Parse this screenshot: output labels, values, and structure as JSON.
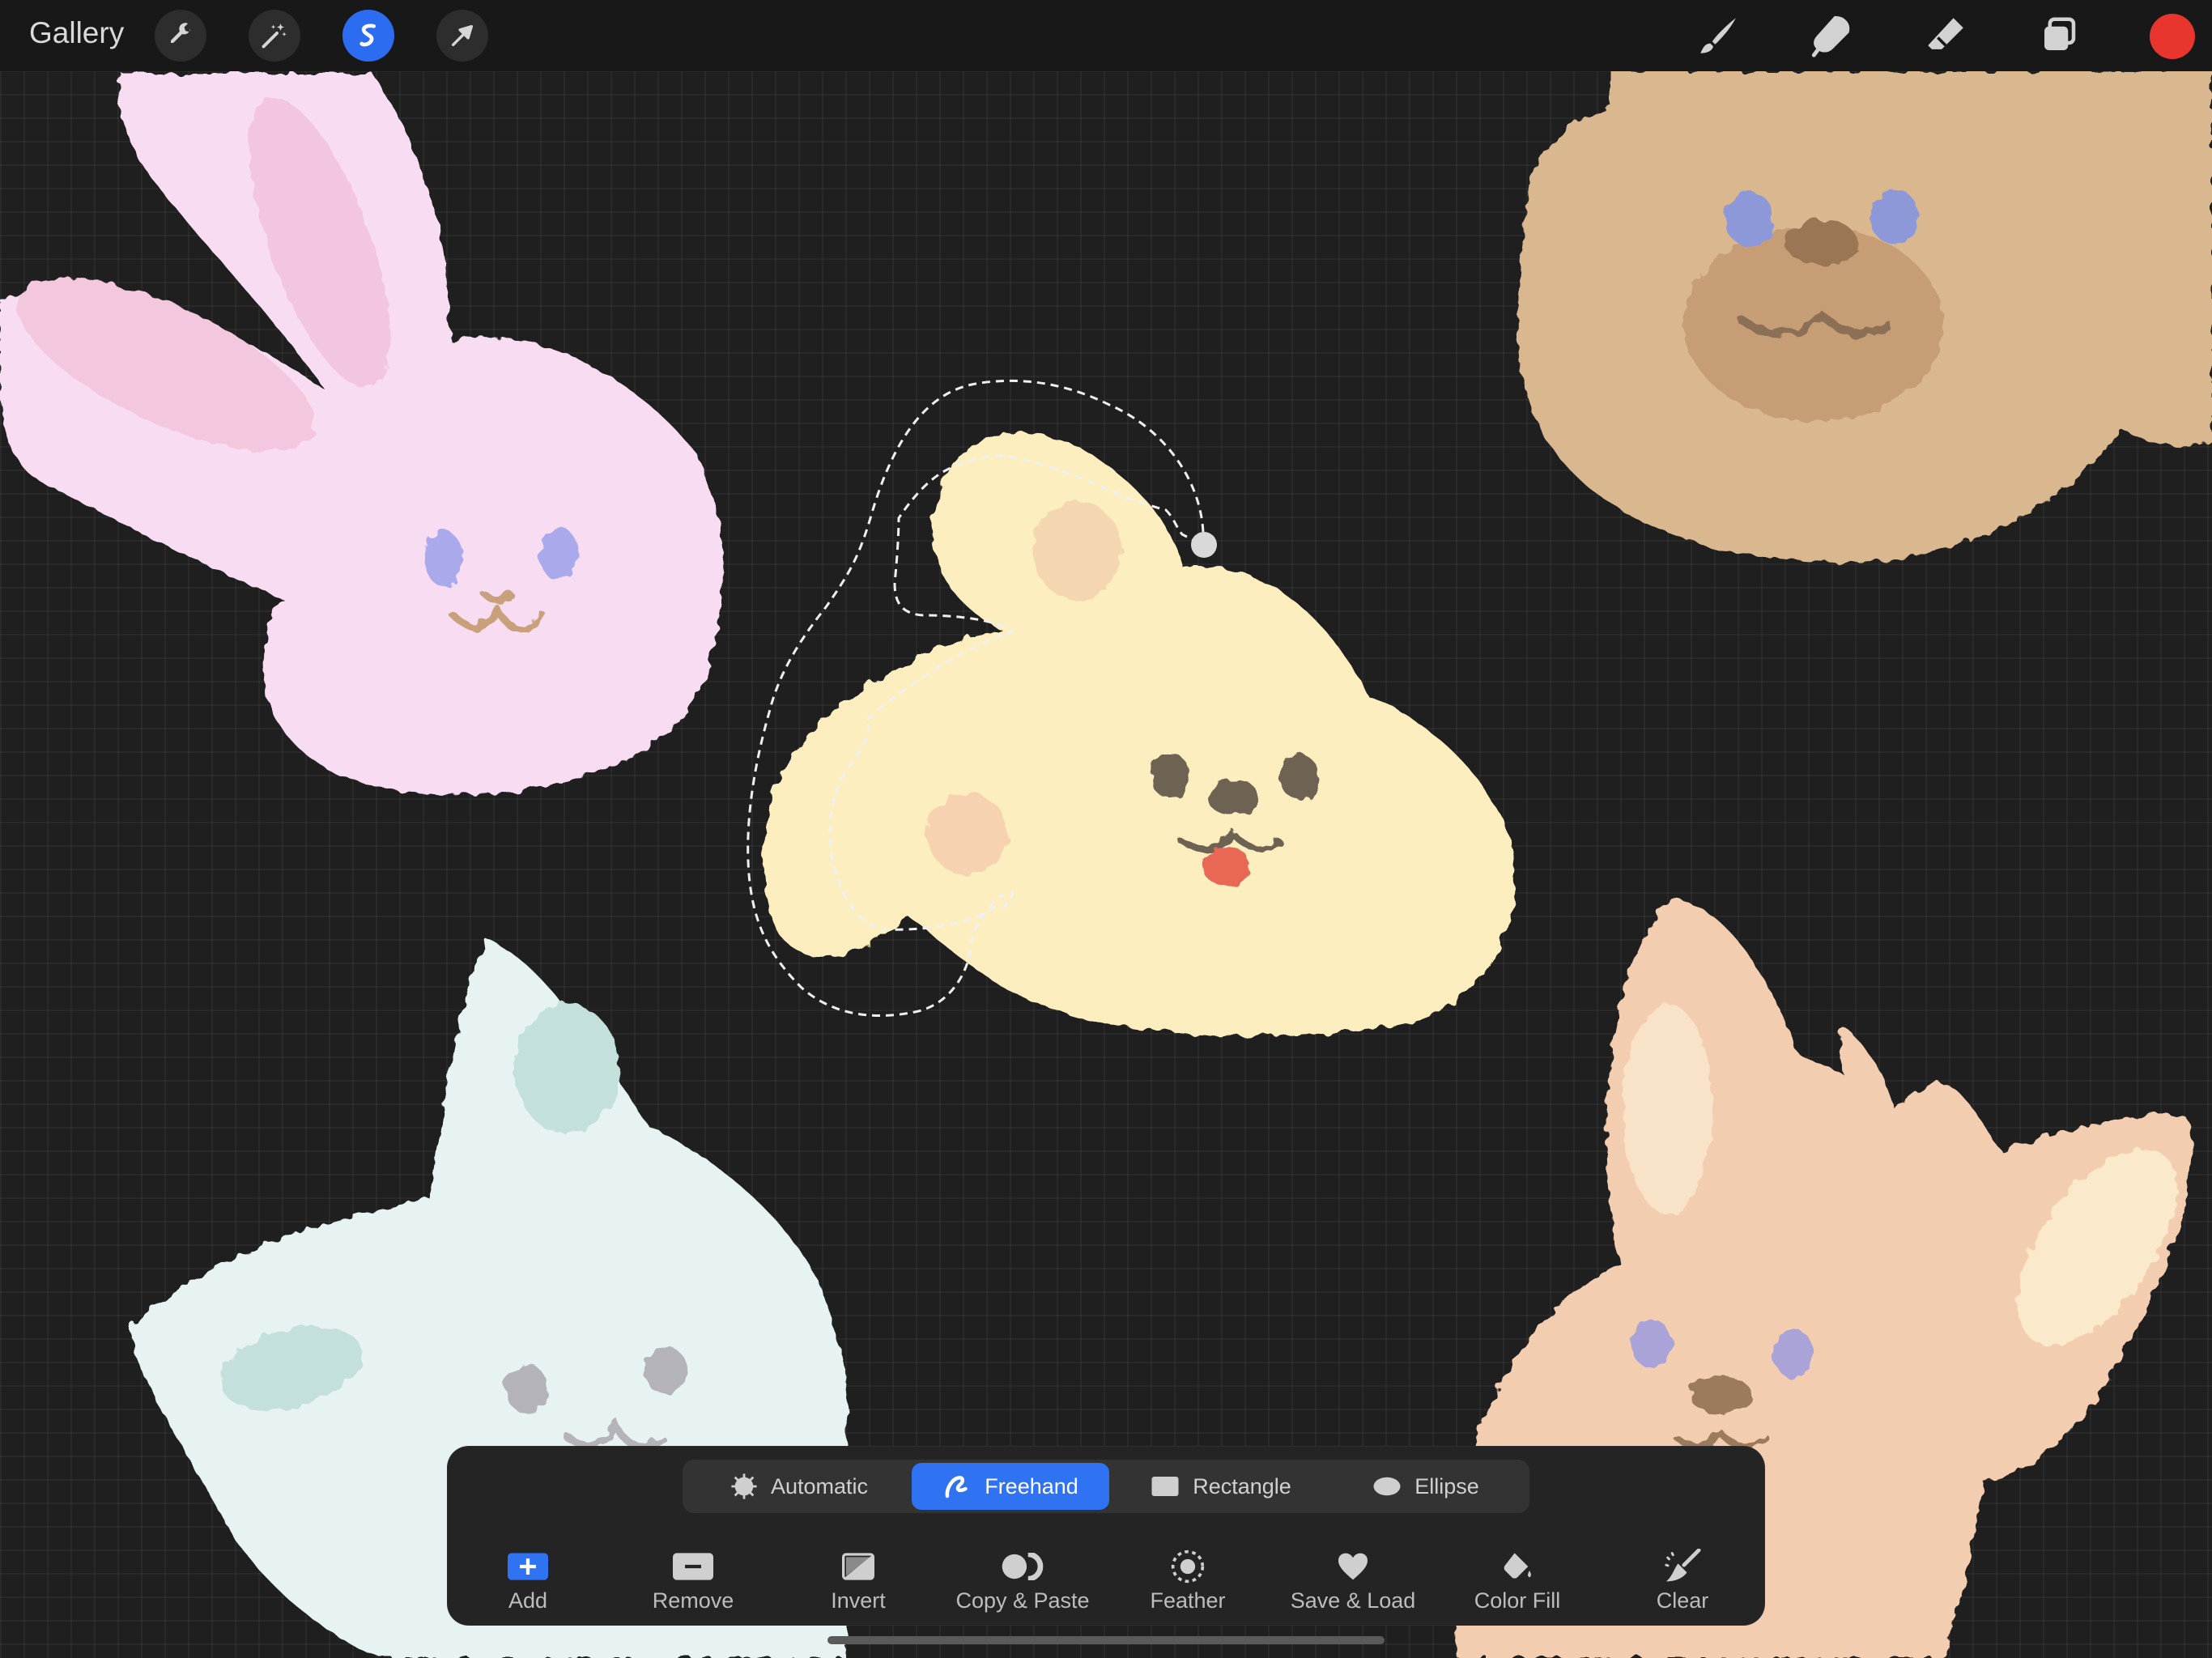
{
  "topbar": {
    "gallery_label": "Gallery",
    "left_tools": [
      {
        "icon": "wrench-icon",
        "active": false
      },
      {
        "icon": "magic-wand-icon",
        "active": false
      },
      {
        "icon": "selection-s-icon",
        "active": true
      },
      {
        "icon": "transform-arrow-icon",
        "active": false
      }
    ],
    "right_tools": [
      "brush-icon",
      "smudge-icon",
      "eraser-icon",
      "layers-icon"
    ],
    "current_color": "#e8352e"
  },
  "selection_panel": {
    "modes": [
      {
        "label": "Automatic",
        "icon": "automatic-icon",
        "active": false
      },
      {
        "label": "Freehand",
        "icon": "freehand-icon",
        "active": true
      },
      {
        "label": "Rectangle",
        "icon": "rectangle-icon",
        "active": false
      },
      {
        "label": "Ellipse",
        "icon": "ellipse-icon",
        "active": false
      }
    ],
    "actions": [
      {
        "label": "Add",
        "icon": "add-icon"
      },
      {
        "label": "Remove",
        "icon": "remove-icon"
      },
      {
        "label": "Invert",
        "icon": "invert-icon"
      },
      {
        "label": "Copy & Paste",
        "icon": "copy-paste-icon"
      },
      {
        "label": "Feather",
        "icon": "feather-icon"
      },
      {
        "label": "Save & Load",
        "icon": "heart-icon"
      },
      {
        "label": "Color Fill",
        "icon": "color-fill-icon"
      },
      {
        "label": "Clear",
        "icon": "clear-icon"
      }
    ]
  },
  "colors": {
    "accent": "#2f72f2",
    "canvas": "#1f1f1f",
    "panel": "#242424"
  }
}
